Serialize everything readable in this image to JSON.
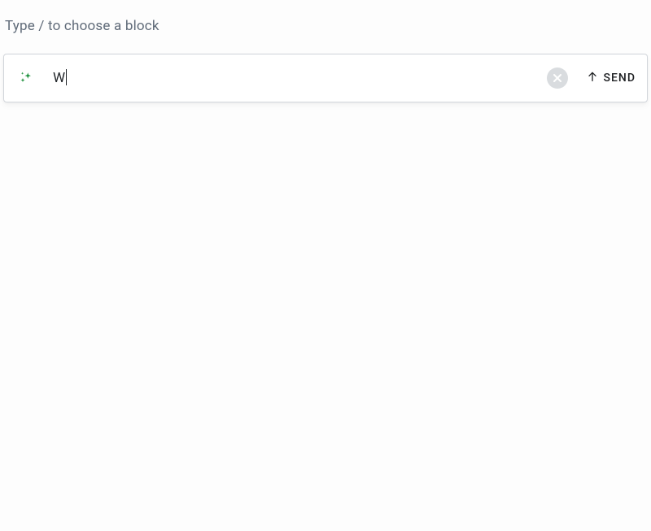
{
  "placeholder_hint": "Type / to choose a block",
  "input": {
    "value": "W",
    "sparkle_color": "#1a8f3a"
  },
  "actions": {
    "send_label": "SEND"
  }
}
